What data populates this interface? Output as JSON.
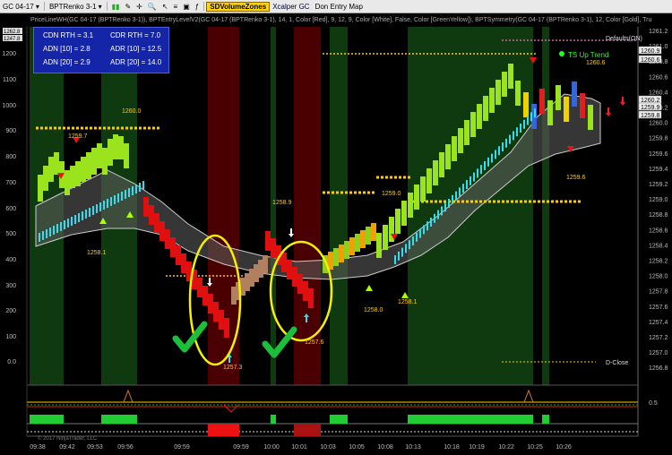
{
  "toolbar": {
    "instrument": "GC 04-17",
    "chart_type": "BPTRenko 3-1",
    "indicator_button": "SDVolumeZones",
    "xcalper": "Xcalper GC",
    "entry_map": "Don Entry Map"
  },
  "indicator_line": "PriceLineWH(GC 04-17 (BPTRenko 3-1)), BPTEntryLevelV2(GC 04-17 (BPTRenko 3-1), 14, 1, Color [Red], 9, 12, 9, Color [White], False, Color [GreenYellow]), BPTSymmetry(GC 04-17 (BPTRenko 3-1), 12, Color [Gold], Tru",
  "info_box": {
    "cdn_rth": "CDN RTH = 3.1",
    "cdr_rth": "CDR RTH = 7.0",
    "adn10": "ADN [10] = 2.8",
    "adr10": "ADR [10] = 12.5",
    "adn20": "ADN [20] = 2.9",
    "adr20": "ADR [20] = 14.0"
  },
  "left_axis": [
    "1262.8",
    "1247.8",
    "1200",
    "1100",
    "1000",
    "900",
    "800",
    "700",
    "600",
    "500",
    "400",
    "300",
    "200",
    "100",
    "0.0"
  ],
  "right_axis": [
    "1261.2",
    "1261.0",
    "1260.8",
    "1260.6",
    "1260.4",
    "1260.2",
    "1260.0",
    "1259.8",
    "1259.6",
    "1259.4",
    "1259.2",
    "1259.0",
    "1258.8",
    "1258.6",
    "1258.4",
    "1258.2",
    "1258.0",
    "1257.8",
    "1257.6",
    "1257.4",
    "1257.2",
    "1257.0",
    "1256.8"
  ],
  "price_tags": [
    "1260.9",
    "1260.6",
    "1260.2",
    "1259.9",
    "1259.8"
  ],
  "osc_axis": "0.5",
  "time_labels": [
    "09:38",
    "09:42",
    "09:53",
    "09:56",
    "09:59",
    "09:59",
    "09:59",
    "09:59",
    "10:00",
    "10:01",
    "10:03",
    "10:05",
    "10:08",
    "10:13",
    "10:18",
    "10:19",
    "10:22",
    "10:25",
    "10:26"
  ],
  "annotations": {
    "p1": "1260.0",
    "p2": "1259.7",
    "p3": "1258.1",
    "p4": "1258.9",
    "p5": "1259.0",
    "p6": "1258.0",
    "p7": "1258.1",
    "p8": "1257.6",
    "p9": "1257.3",
    "p10": "1259.6",
    "p11": "1260.6",
    "trend": "TS Up Trend",
    "dclose": "D-Close",
    "defaults": "Defaults(ON)"
  },
  "copyright": "© 2017 NinjaTrader, LLC",
  "colors": {
    "green_zone": "#0f3a0f",
    "red_zone": "#4a0000",
    "up_bar": "#9be31c",
    "down_bar": "#e01010",
    "gold": "#ffcc00",
    "cyan": "#33ddee"
  }
}
